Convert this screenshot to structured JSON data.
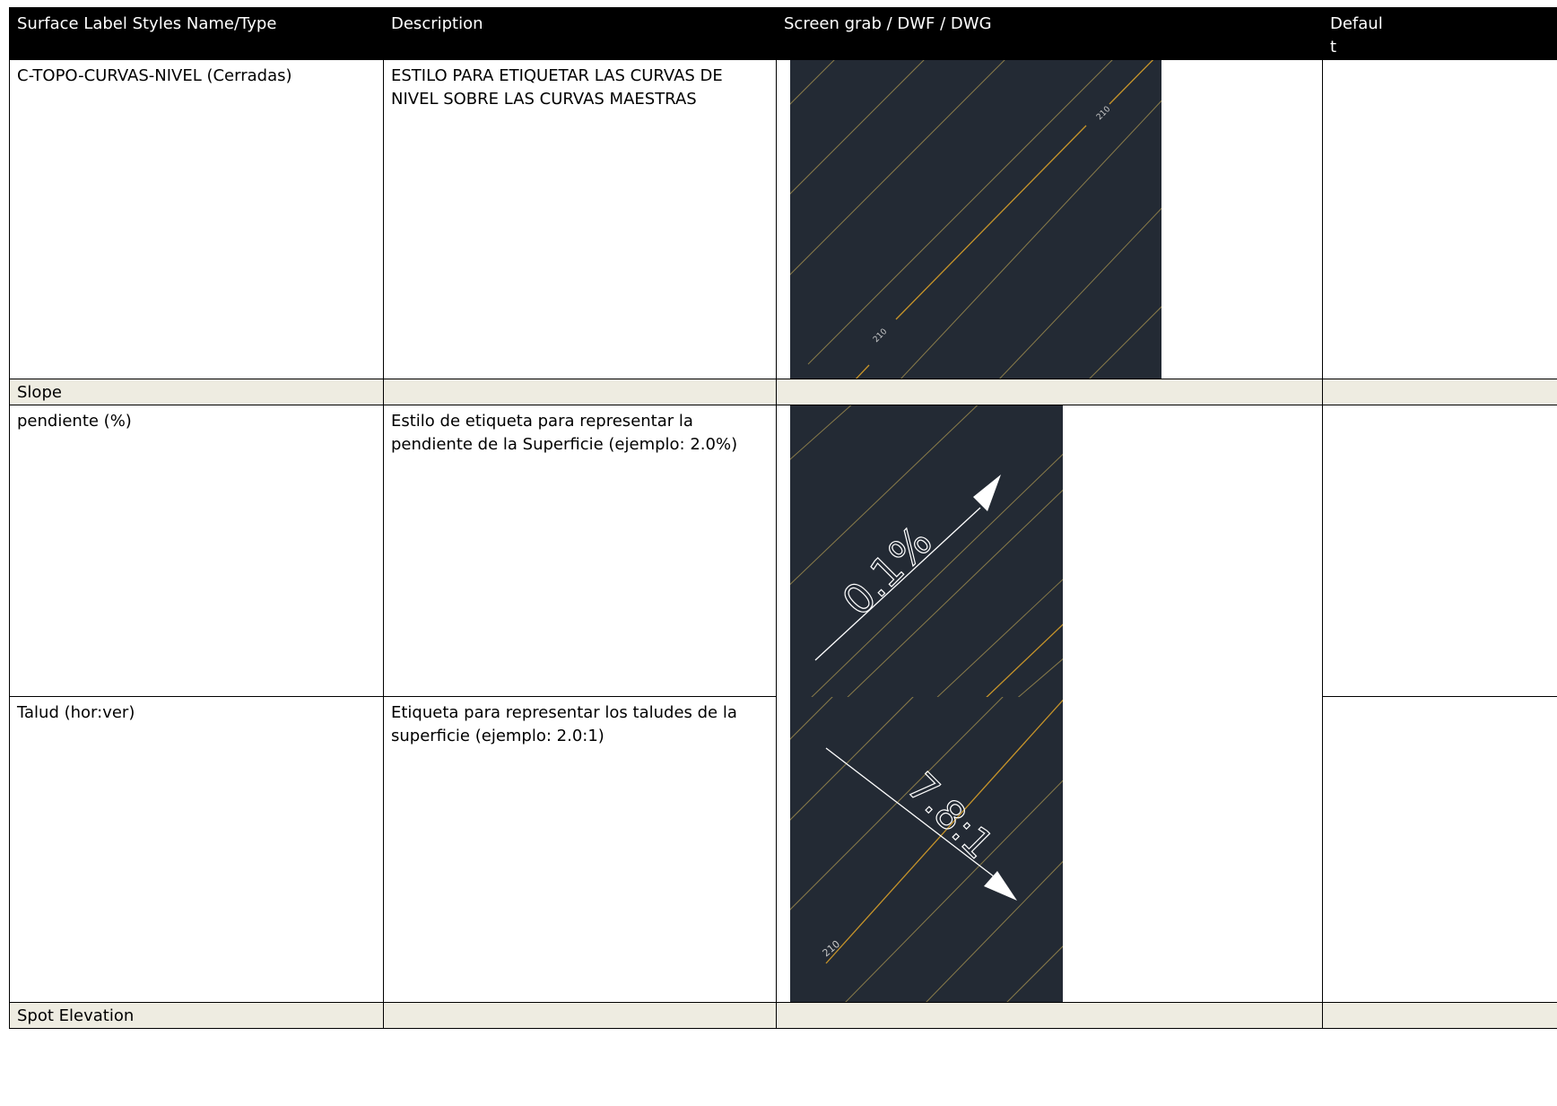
{
  "header": {
    "col_name": "Surface Label Styles Name/Type",
    "col_description": "Description",
    "col_screen": "Screen grab / DWF / DWG",
    "col_default": "Default"
  },
  "rows": {
    "curvas": {
      "name": "C-TOPO-CURVAS-NIVEL (Cerradas)",
      "description": "ESTILO PARA ETIQUETAR LAS CURVAS DE NIVEL SOBRE LAS CURVAS MAESTRAS",
      "label_upper": "210",
      "label_lower": "210"
    },
    "slope_section": {
      "title": "Slope"
    },
    "pendiente": {
      "name": "pendiente (%)",
      "description": "Estilo de etiqueta para representar la pendiente de la Superficie (ejemplo: 2.0%)",
      "label": "0.1%"
    },
    "talud": {
      "name": "Talud (hor:ver)",
      "description": "Etiqueta para representar los taludes de la superficie (ejemplo: 2.0:1)",
      "label": "7.8:1",
      "contour_label": "210"
    },
    "spot_section": {
      "title": "Spot Elevation"
    }
  },
  "colors": {
    "drawing_bg": "#232a34",
    "contour_minor": "#9a8a50",
    "contour_major": "#d9a229",
    "annotation": "#ffffff",
    "section_bg": "#eeece1"
  }
}
